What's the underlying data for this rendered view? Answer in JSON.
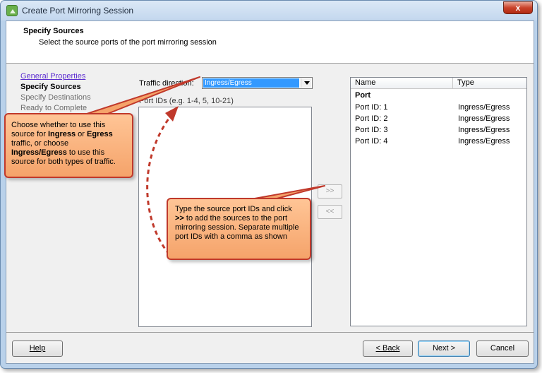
{
  "window": {
    "title": "Create Port Mirroring Session",
    "close_label": "x"
  },
  "header": {
    "title": "Specify Sources",
    "subtitle": "Select the source ports of the port mirroring session"
  },
  "steps": [
    {
      "label": "General Properties",
      "state": "link"
    },
    {
      "label": "Specify Sources",
      "state": "current"
    },
    {
      "label": "Specify Destinations",
      "state": "disabled"
    },
    {
      "label": "Ready to Complete",
      "state": "disabled"
    }
  ],
  "traffic": {
    "label": "Traffic direction:",
    "selected": "Ingress/Egress"
  },
  "port_ids": {
    "label": "Port IDs (e.g. 1-4, 5, 10-21)",
    "value": ""
  },
  "move_buttons": {
    "add_label": ">>",
    "remove_label": "<<"
  },
  "table": {
    "columns": [
      "Name",
      "Type"
    ],
    "group": "Port",
    "rows": [
      {
        "name": "Port ID: 1",
        "type": "Ingress/Egress"
      },
      {
        "name": "Port ID: 2",
        "type": "Ingress/Egress"
      },
      {
        "name": "Port ID: 3",
        "type": "Ingress/Egress"
      },
      {
        "name": "Port ID: 4",
        "type": "Ingress/Egress"
      }
    ]
  },
  "footer": {
    "help": "Help",
    "back": "< Back",
    "next": "Next >",
    "cancel": "Cancel"
  },
  "callouts": {
    "direction": {
      "t1": "Choose whether to use this source for ",
      "b1": "Ingress",
      "t2": " or ",
      "b2": "Egress",
      "t3": " traffic, or choose ",
      "b3": "Ingress/Egress",
      "t4": " to use this source for both types of traffic."
    },
    "ports": {
      "t1": "Type the source port IDs and click ",
      "b1": ">>",
      "t2": " to add the sources to the port mirroring session. Separate multiple port IDs with a comma as shown"
    }
  },
  "colors": {
    "callout_fill": "#f5a36a",
    "callout_border": "#c0392b",
    "selection": "#3399ff",
    "link": "#5e2fd0"
  },
  "icons": {
    "app": "port-mirror-app-icon",
    "close": "close-icon",
    "dropdown": "chevron-down-icon"
  }
}
